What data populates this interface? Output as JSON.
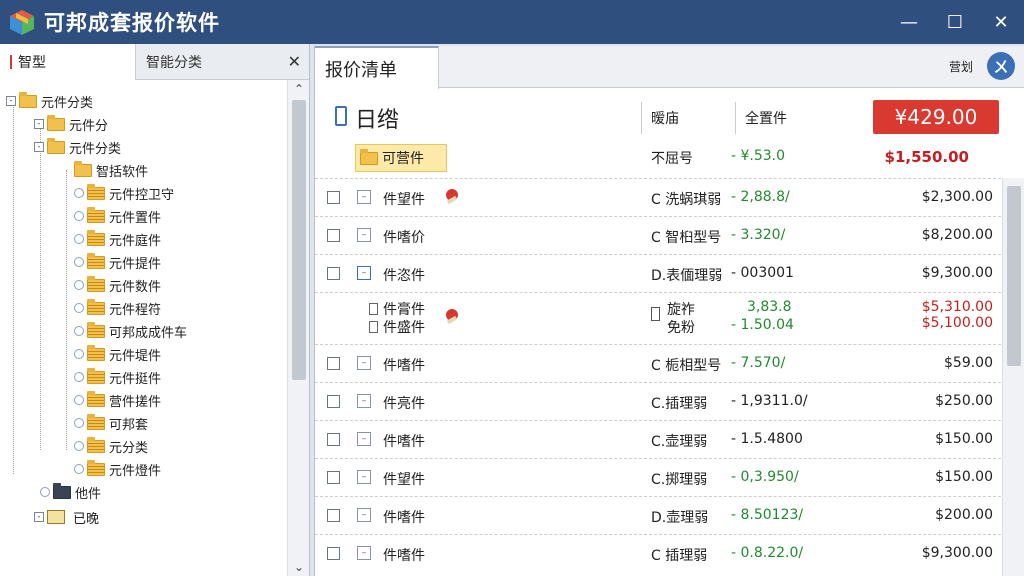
{
  "window": {
    "title": "可邦成套报价软件",
    "controls": {
      "minimize": "—",
      "maximize": "☐",
      "close": "✕"
    }
  },
  "left": {
    "tabs": [
      {
        "label": "智型",
        "active": true
      },
      {
        "label": "智能分类",
        "active": false
      }
    ],
    "close": "✕",
    "tree": [
      {
        "label": "元件分类",
        "toggle": "-",
        "level": 0,
        "icon": "folder"
      },
      {
        "label": "元件分",
        "toggle": "-",
        "level": 1,
        "icon": "folder"
      },
      {
        "label": "元件分类",
        "toggle": "-",
        "level": 1,
        "icon": "folder"
      },
      {
        "label": "智括软件",
        "toggle": "",
        "level": 2,
        "icon": "folder"
      },
      {
        "label": "元件控卫守",
        "toggle": "",
        "level": 2,
        "icon": "folder-lines"
      },
      {
        "label": "元件置件",
        "toggle": "",
        "level": 2,
        "icon": "folder-lines"
      },
      {
        "label": "元件庭件",
        "toggle": "",
        "level": 2,
        "icon": "folder-lines"
      },
      {
        "label": "元件提件",
        "toggle": "",
        "level": 2,
        "icon": "folder-lines"
      },
      {
        "label": "元件数件",
        "toggle": "",
        "level": 2,
        "icon": "folder-lines"
      },
      {
        "label": "元件程符",
        "toggle": "",
        "level": 2,
        "icon": "folder-lines"
      },
      {
        "label": "可邦成成件车",
        "toggle": "",
        "level": 2,
        "icon": "folder-lines"
      },
      {
        "label": "元件堤件",
        "toggle": "",
        "level": 2,
        "icon": "folder-lines"
      },
      {
        "label": "元件挺件",
        "toggle": "",
        "level": 2,
        "icon": "folder-lines"
      },
      {
        "label": "营件搓件",
        "toggle": "",
        "level": 2,
        "icon": "folder-lines"
      },
      {
        "label": "可邦套",
        "toggle": "",
        "level": 2,
        "icon": "folder-lines"
      },
      {
        "label": "元分类",
        "toggle": "",
        "level": 2,
        "icon": "folder-lines"
      },
      {
        "label": "元件燈件",
        "toggle": "",
        "level": 2,
        "icon": "folder-lines"
      },
      {
        "label": "他件",
        "toggle": "",
        "level": 1,
        "icon": "folder-dark"
      },
      {
        "label": "已晚",
        "toggle": "-",
        "level": 0,
        "icon": "box"
      }
    ],
    "scroll_up": "⌃",
    "scroll_down": "⌄"
  },
  "right": {
    "tab_label": "报价清单",
    "top_right_label": "营划",
    "round_button_glyph": "ㄨ",
    "header": {
      "title": "日绺",
      "col1": "暧庙",
      "col2": "全置件",
      "total": "¥429.00"
    },
    "group_label": "可营件",
    "group_type": "不屈号",
    "group_qty": "- ¥.53.0",
    "group_price": "$1,550.00",
    "rows": [
      {
        "name": "件望件",
        "type": "C 洗蜗琪弱",
        "qty": "- 2,88.8/",
        "price": "$2,300.00",
        "qty_color": "green",
        "price_color": "normal",
        "pin": true
      },
      {
        "name": "件嗜价",
        "type": "C 智桕型号",
        "qty": "- 3.320/",
        "price": "$8,200.00",
        "qty_color": "green",
        "price_color": "normal",
        "pin": false
      },
      {
        "name": "件恣件",
        "type": "D.表偭理弱",
        "qty": "- 003001",
        "price": "$9,300.00",
        "qty_color": "normal",
        "price_color": "normal",
        "pin": false
      },
      {
        "name": "件膏件",
        "name2": "件盛件",
        "type": "旋祚",
        "type2": "免粉",
        "qty": "3,83.8",
        "qty2": "- 1.50.04",
        "price": "$5,310.00",
        "price2": "$5,100.00",
        "qty_color": "green",
        "price_color": "red",
        "pin": true,
        "double": true
      },
      {
        "name": "件嗜件",
        "type": "C 栀相型号",
        "qty": "- 7.570/",
        "price": "$59.00",
        "qty_color": "green",
        "price_color": "normal",
        "pin": false
      },
      {
        "name": "件亮件",
        "type": "C.插理弱",
        "qty": "- 1,9311.0/",
        "price": "$250.00",
        "qty_color": "normal",
        "price_color": "normal",
        "pin": false
      },
      {
        "name": "件嗜件",
        "type": "C.壶理弱",
        "qty": "- 1.5.4800",
        "price": "$150.00",
        "qty_color": "normal",
        "price_color": "normal",
        "pin": false
      },
      {
        "name": "件望件",
        "type": "C.掷理弱",
        "qty": "- 0,3.950/",
        "price": "$150.00",
        "qty_color": "green",
        "price_color": "normal",
        "pin": false
      },
      {
        "name": "件嗜件",
        "type": "D.壶理弱",
        "qty": "- 8.50123/",
        "price": "$200.00",
        "qty_color": "green",
        "price_color": "normal",
        "pin": false
      },
      {
        "name": "件嗜件",
        "type": "C 插理弱",
        "qty": "- 0.8.22.0/",
        "price": "$9,300.00",
        "qty_color": "green",
        "price_color": "normal",
        "pin": false
      }
    ]
  }
}
